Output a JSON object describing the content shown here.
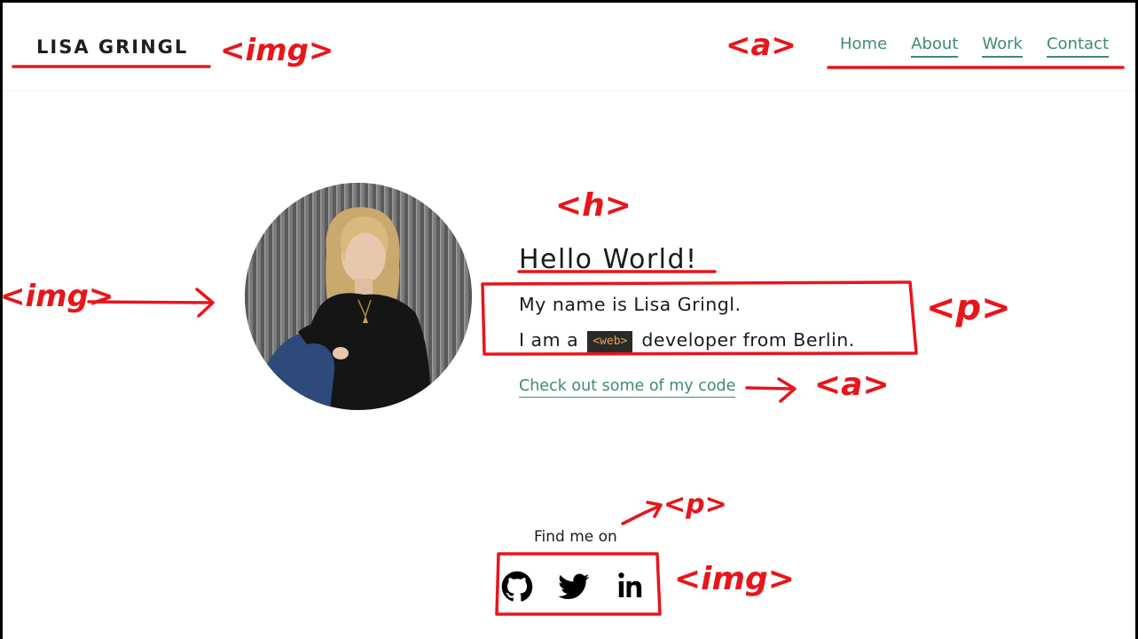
{
  "header": {
    "logo": "LISA GRINGL",
    "nav": [
      {
        "label": "Home"
      },
      {
        "label": "About"
      },
      {
        "label": "Work"
      },
      {
        "label": "Contact"
      }
    ]
  },
  "hero": {
    "title": "Hello World!",
    "intro_line1": "My name is Lisa Gringl.",
    "intro_line2_before": "I am a",
    "web_tag": "<web>",
    "intro_line2_after": "developer from Berlin.",
    "code_link": "Check out some of my code"
  },
  "social": {
    "heading": "Find me on",
    "links": [
      {
        "icon": "github-icon"
      },
      {
        "icon": "twitter-icon"
      },
      {
        "icon": "linkedin-icon"
      }
    ]
  },
  "annotations": {
    "color": "#e8151b",
    "img_logo": "<img>",
    "a_nav": "<a>",
    "h_title": "<h>",
    "img_portrait": "<img>",
    "p_intro": "<p>",
    "a_code": "<a>",
    "p_find": "<p>",
    "img_social": "<img>"
  },
  "colors": {
    "accent": "#3f8a72",
    "web_tag_bg": "#2a2a2a",
    "web_tag_text": "#e0a84a"
  }
}
